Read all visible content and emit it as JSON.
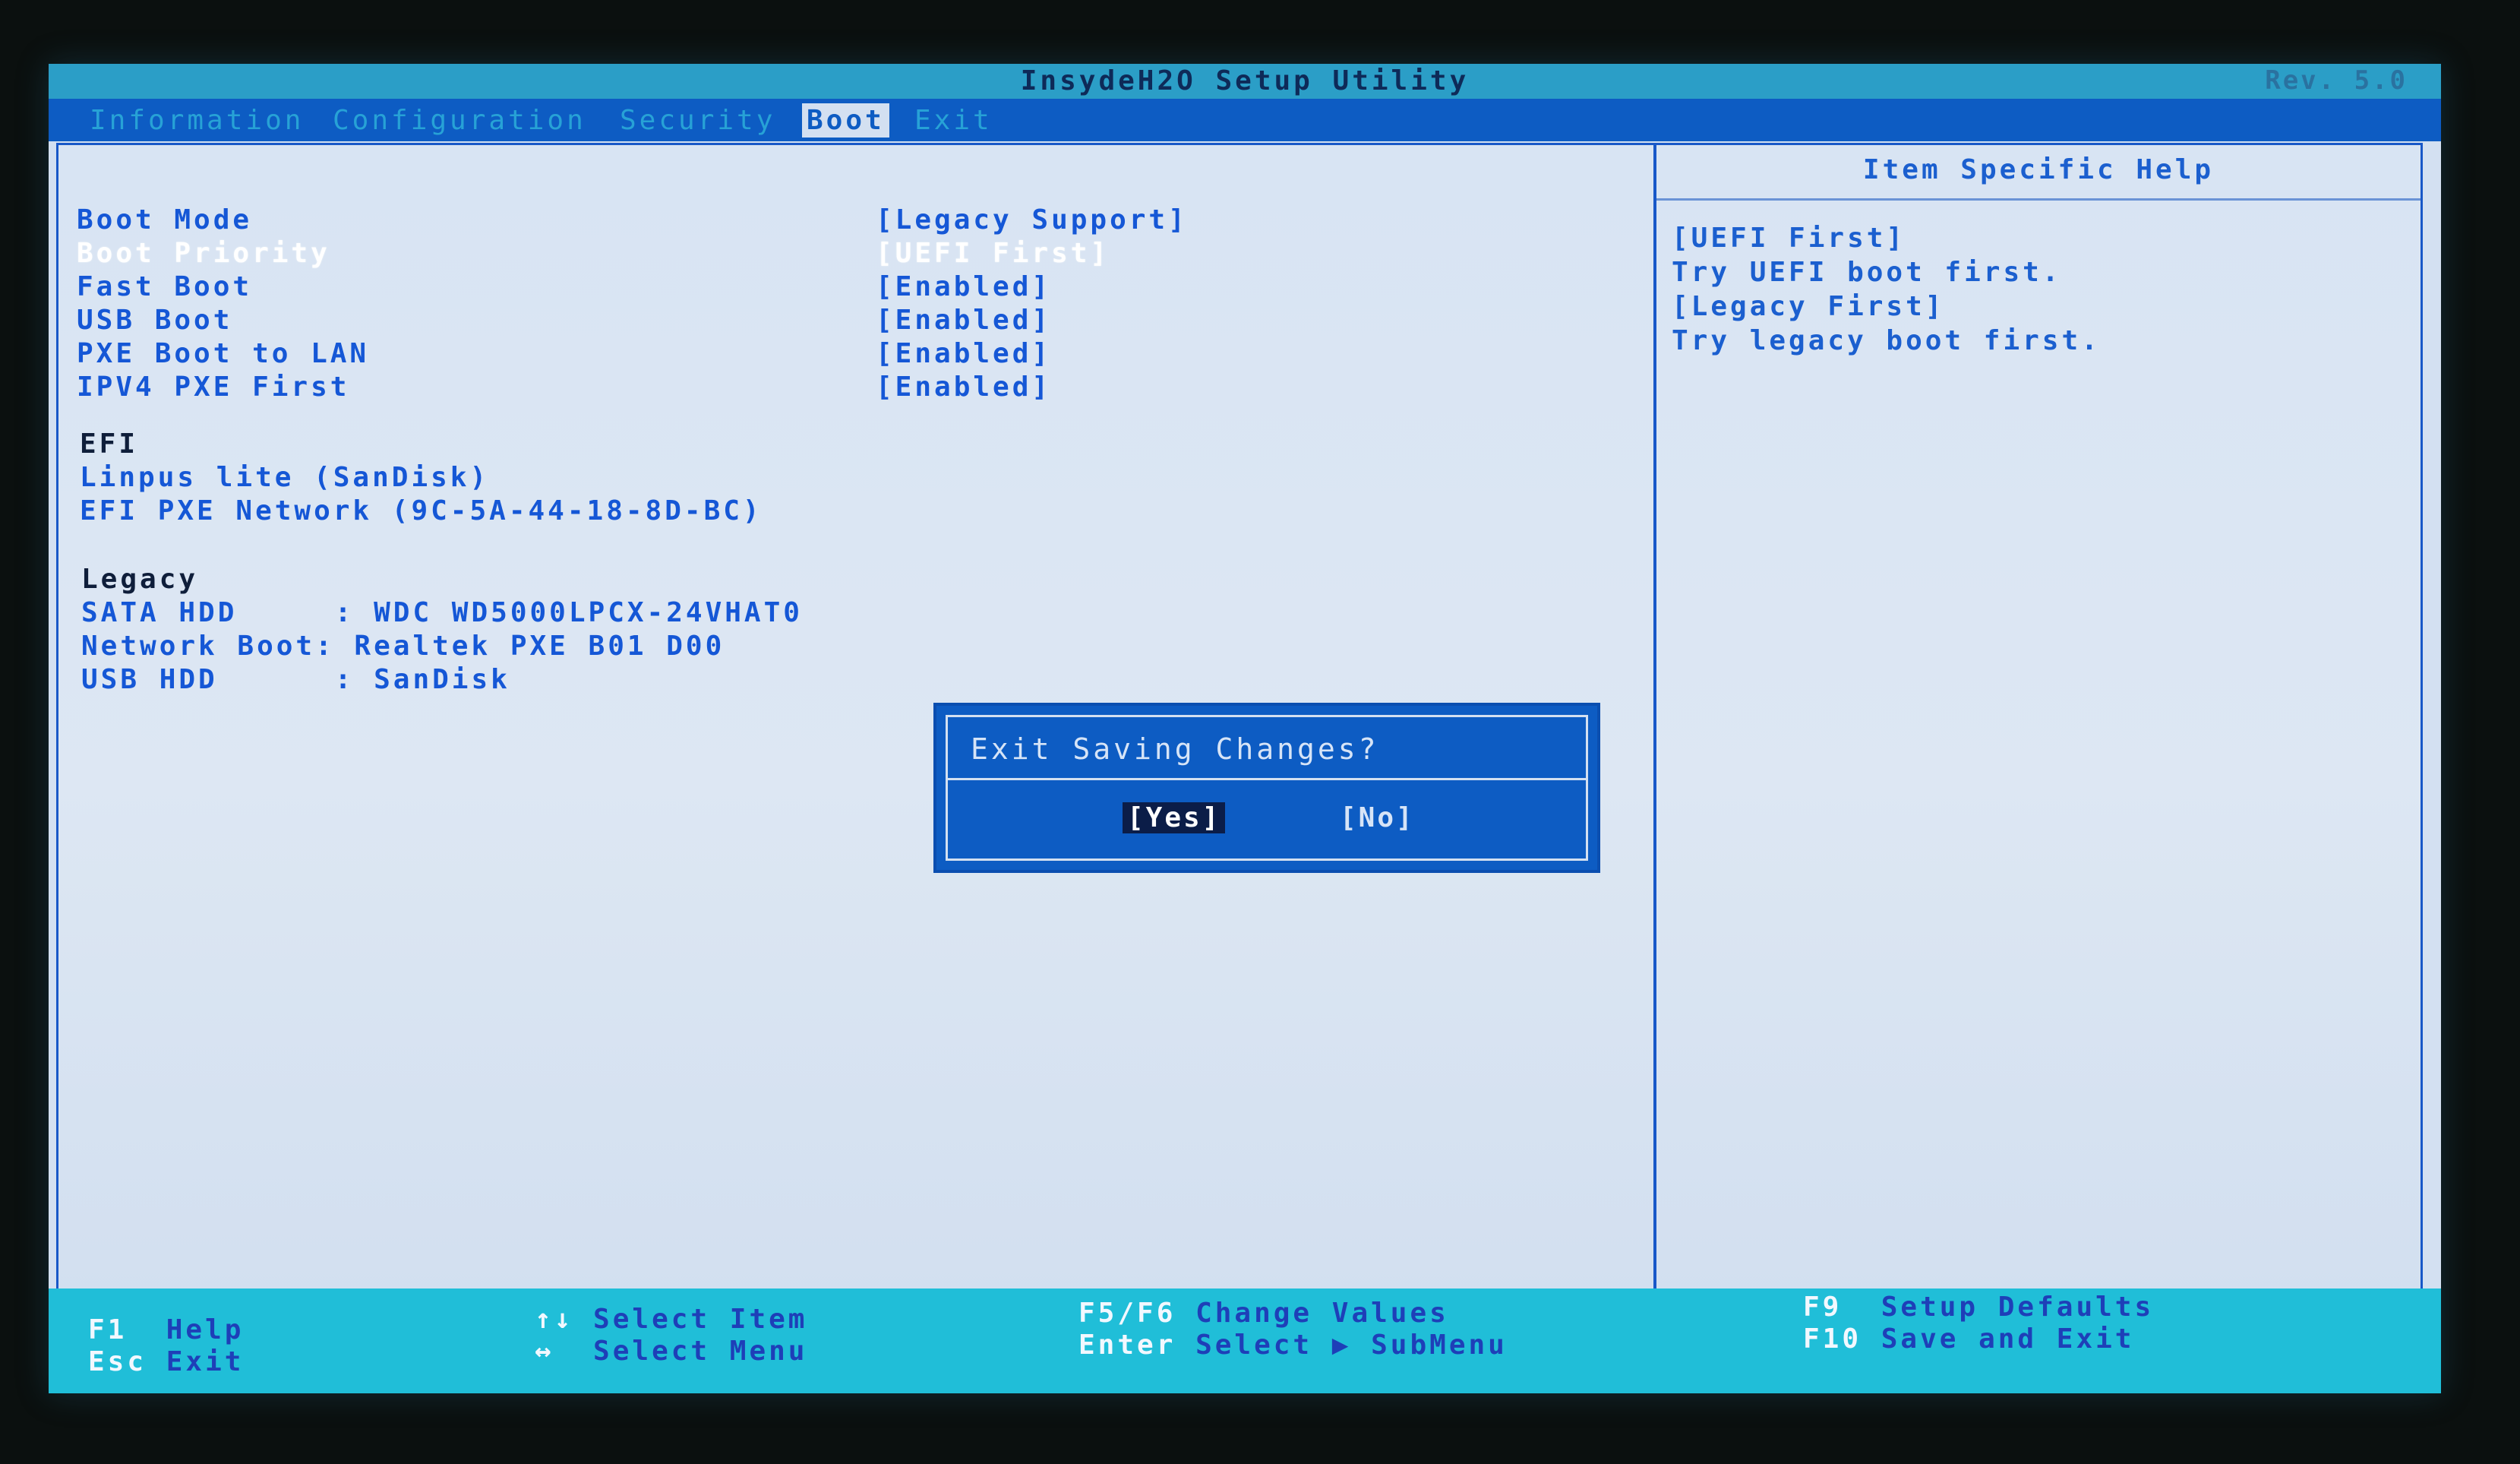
{
  "window": {
    "title": "InsydeH2O Setup Utility",
    "revision": "Rev. 5.0"
  },
  "menu": {
    "items": [
      {
        "label": "Information"
      },
      {
        "label": "Configuration"
      },
      {
        "label": "Security"
      },
      {
        "label": "Boot"
      },
      {
        "label": "Exit"
      }
    ],
    "active": "Boot"
  },
  "settings": [
    {
      "label": "Boot Mode",
      "value": "[Legacy Support]"
    },
    {
      "label": "Boot Priority",
      "value": "[UEFI First]",
      "selected": true
    },
    {
      "label": "Fast Boot",
      "value": "[Enabled]"
    },
    {
      "label": "USB Boot",
      "value": "[Enabled]"
    },
    {
      "label": "PXE Boot to LAN",
      "value": "[Enabled]"
    },
    {
      "label": "IPV4 PXE First",
      "value": "[Enabled]"
    }
  ],
  "efi": {
    "title": "EFI",
    "entries": [
      "Linpus lite (SanDisk)",
      "EFI PXE Network (9C-5A-44-18-8D-BC)"
    ]
  },
  "legacy": {
    "title": "Legacy",
    "entries": [
      "SATA HDD     : WDC WD5000LPCX-24VHAT0",
      "Network Boot: Realtek PXE B01 D00",
      "USB HDD      : SanDisk"
    ]
  },
  "help": {
    "title": "Item Specific Help",
    "lines": [
      "[UEFI First]",
      "Try UEFI boot first.",
      "[Legacy First]",
      "Try legacy boot first."
    ]
  },
  "dialog": {
    "message": "Exit Saving Changes?",
    "yes": "[Yes]",
    "no": "[No]"
  },
  "footer": {
    "f1": {
      "key": "F1",
      "action": "Help"
    },
    "esc": {
      "key": "Esc",
      "action": "Exit"
    },
    "select_item": {
      "key": "↑↓",
      "action": "Select Item"
    },
    "select_menu": {
      "key": "↔",
      "action": "Select Menu"
    },
    "f5f6": {
      "key": "F5/F6",
      "action": "Change Values"
    },
    "enter": {
      "key": "Enter",
      "action": "Select ▶ SubMenu"
    },
    "f9": {
      "key": "F9",
      "action": "Setup Defaults"
    },
    "f10": {
      "key": "F10",
      "action": "Save and Exit"
    }
  },
  "colors": {
    "menu_bar": "#0d5cc3",
    "title_bar": "#2b9ec7",
    "footer": "#20bed8",
    "text_blue": "#1557d6",
    "background": "#d3e0f1"
  }
}
